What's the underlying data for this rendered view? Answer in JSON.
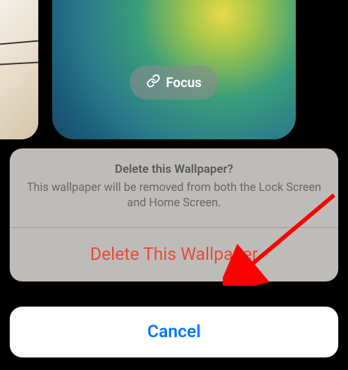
{
  "wallpaper": {
    "focus_label": "Focus"
  },
  "sheet": {
    "title": "Delete this Wallpaper?",
    "message": "This wallpaper will be removed from both the Lock Screen and Home Screen.",
    "delete_action": "Delete This Wallpaper",
    "cancel_action": "Cancel"
  },
  "colors": {
    "destructive": "#e84a3a",
    "primary": "#007aff"
  }
}
